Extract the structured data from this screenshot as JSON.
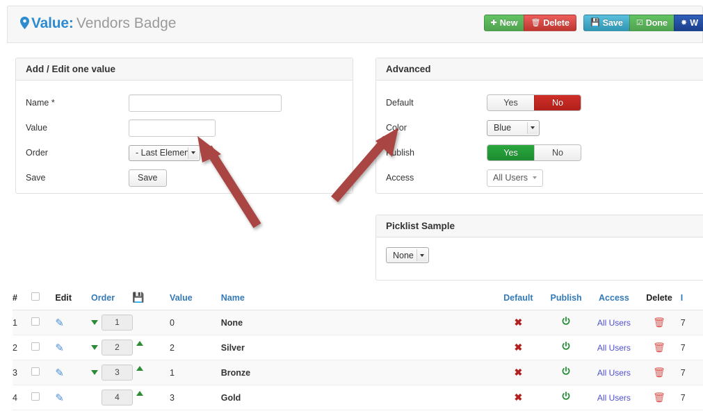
{
  "header": {
    "pin_icon": "map-pin-icon",
    "title_main": "Value",
    "title_sep": ":",
    "title_sub": "Vendors Badge"
  },
  "toolbar": {
    "buttons": [
      {
        "label": "New",
        "icon": "plus-icon",
        "glyph": "✚",
        "color": "#51a351"
      },
      {
        "label": "Delete",
        "icon": "trash-icon",
        "glyph": "🗑",
        "color": "#bd362f"
      },
      {
        "label": "Save",
        "icon": "floppy-disk-icon",
        "glyph": "💾",
        "color": "#2f96b4"
      },
      {
        "label": "Done",
        "icon": "check-box-icon",
        "glyph": "☑",
        "color": "#51a351"
      },
      {
        "label": "W",
        "icon": "magic-wand-icon",
        "glyph": "╱",
        "color": "#1b3f8b"
      }
    ]
  },
  "add_edit_panel": {
    "title": "Add / Edit one value",
    "name_label": "Name *",
    "name_value": "",
    "name_placeholder": "",
    "value_label": "Value",
    "value_value": "",
    "value_placeholder": "",
    "order_label": "Order",
    "order_selected": "- Last Element -",
    "save_label": "Save",
    "save_button": "Save"
  },
  "advanced_panel": {
    "title": "Advanced",
    "default_label": "Default",
    "default_yes": "Yes",
    "default_no": "No",
    "default_selected": "No",
    "color_label": "Color",
    "color_selected": "Blue",
    "publish_label": "Publish",
    "publish_yes": "Yes",
    "publish_no": "No",
    "publish_selected": "Yes",
    "access_label": "Access",
    "access_selected": "All Users"
  },
  "picklist_panel": {
    "title": "Picklist Sample",
    "selected": "None"
  },
  "table": {
    "headers": {
      "num": "#",
      "select_all": "",
      "edit": "Edit",
      "order": "Order",
      "save_icon": "floppy-disk-icon",
      "value": "Value",
      "name": "Name",
      "default": "Default",
      "publish": "Publish",
      "access": "Access",
      "delete": "Delete",
      "id": "I"
    },
    "rows": [
      {
        "num": "1",
        "order": "1",
        "value": "0",
        "name": "None",
        "access": "All Users",
        "id": "7",
        "down": true,
        "up": false
      },
      {
        "num": "2",
        "order": "2",
        "value": "2",
        "name": "Silver",
        "access": "All Users",
        "id": "7",
        "down": true,
        "up": true
      },
      {
        "num": "3",
        "order": "3",
        "value": "1",
        "name": "Bronze",
        "access": "All Users",
        "id": "7",
        "down": true,
        "up": true
      },
      {
        "num": "4",
        "order": "4",
        "value": "3",
        "name": "Gold",
        "access": "All Users",
        "id": "7",
        "down": false,
        "up": true
      }
    ]
  },
  "annotations": {
    "arrow_color": "#a94442",
    "arrow_1_target": "order-select",
    "arrow_2_target": "color-select"
  }
}
